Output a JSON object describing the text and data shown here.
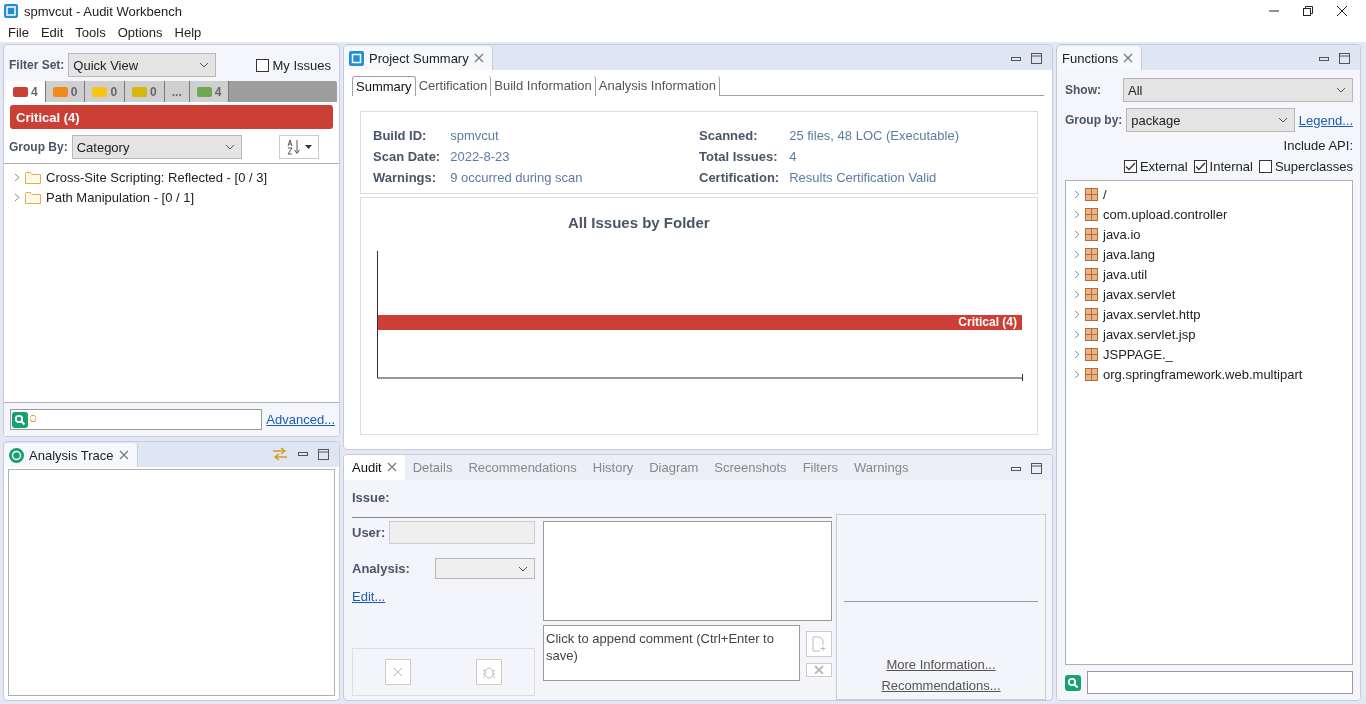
{
  "window": {
    "title": "spmvcut - Audit Workbench"
  },
  "menu": [
    "File",
    "Edit",
    "Tools",
    "Options",
    "Help"
  ],
  "issues_panel": {
    "filter_set_label": "Filter Set:",
    "filter_set": "Quick View",
    "my_issues": {
      "label": "My Issues",
      "checked": false
    },
    "severity_tabs": [
      {
        "kind": "count",
        "color": "#cc3f36",
        "count": "4",
        "selected": true
      },
      {
        "kind": "count",
        "color": "#f08a1c",
        "count": "0",
        "selected": false
      },
      {
        "kind": "count",
        "color": "#f7c614",
        "count": "0",
        "selected": false
      },
      {
        "kind": "count",
        "color": "#d9b60c",
        "count": "0",
        "selected": false
      },
      {
        "kind": "more",
        "label": "...",
        "selected": false
      },
      {
        "kind": "count",
        "color": "#6fa850",
        "count": "4",
        "selected": false
      }
    ],
    "banner": "Critical (4)",
    "group_by_label": "Group By:",
    "group_by": "Category",
    "tree": [
      {
        "label": "Cross-Site Scripting: Reflected - [0 / 3]",
        "expanded": false
      },
      {
        "label": "Path Manipulation - [0 / 1]",
        "expanded": false
      }
    ],
    "advanced_link": "Advanced..."
  },
  "analysis_trace": {
    "title": "Analysis Trace"
  },
  "project_summary": {
    "title": "Project Summary",
    "tabs": [
      {
        "label": "Summary",
        "selected": true
      },
      {
        "label": "Certification",
        "selected": false
      },
      {
        "label": "Build Information",
        "selected": false
      },
      {
        "label": "Analysis Information",
        "selected": false
      }
    ],
    "fields_left": [
      {
        "label": "Build ID:",
        "value": "spmvcut"
      },
      {
        "label": "Scan Date:",
        "value": "2022-8-23"
      },
      {
        "label": "Warnings:",
        "value": "9 occurred during scan"
      }
    ],
    "fields_right": [
      {
        "label": "Scanned:",
        "value": "25 files, 48 LOC (Executable)"
      },
      {
        "label": "Total Issues:",
        "value": "4"
      },
      {
        "label": "Certification:",
        "value": "Results Certification Valid"
      }
    ],
    "chart": {
      "title": "All Issues by Folder",
      "bars": [
        {
          "label": "Critical (4)"
        }
      ]
    }
  },
  "audit": {
    "tabs": [
      {
        "label": "Audit",
        "selected": true
      },
      {
        "label": "Details",
        "selected": false
      },
      {
        "label": "Recommendations",
        "selected": false
      },
      {
        "label": "History",
        "selected": false
      },
      {
        "label": "Diagram",
        "selected": false
      },
      {
        "label": "Screenshots",
        "selected": false
      },
      {
        "label": "Filters",
        "selected": false
      },
      {
        "label": "Warnings",
        "selected": false
      }
    ],
    "issue_label": "Issue:",
    "user_label": "User:",
    "analysis_label": "Analysis:",
    "edit_link": "Edit...",
    "comment_placeholder": "Click to append comment (Ctrl+Enter to save)",
    "more_information_link": "More Information...",
    "recommendations_link": "Recommendations..."
  },
  "functions": {
    "title": "Functions",
    "show_label": "Show:",
    "show": "All",
    "group_by_label": "Group by:",
    "group_by": "package",
    "legend_link": "Legend...",
    "include_api_label": "Include API:",
    "include_api": [
      {
        "label": "External",
        "checked": true
      },
      {
        "label": "Internal",
        "checked": true
      },
      {
        "label": "Superclasses",
        "checked": false
      }
    ],
    "tree": [
      {
        "label": "/"
      },
      {
        "label": "com.upload.controller"
      },
      {
        "label": "java.io"
      },
      {
        "label": "java.lang"
      },
      {
        "label": "java.util"
      },
      {
        "label": "javax.servlet"
      },
      {
        "label": "javax.servlet.http"
      },
      {
        "label": "javax.servlet.jsp"
      },
      {
        "label": "JSPPAGE._"
      },
      {
        "label": "org.springframework.web.multipart"
      }
    ]
  }
}
